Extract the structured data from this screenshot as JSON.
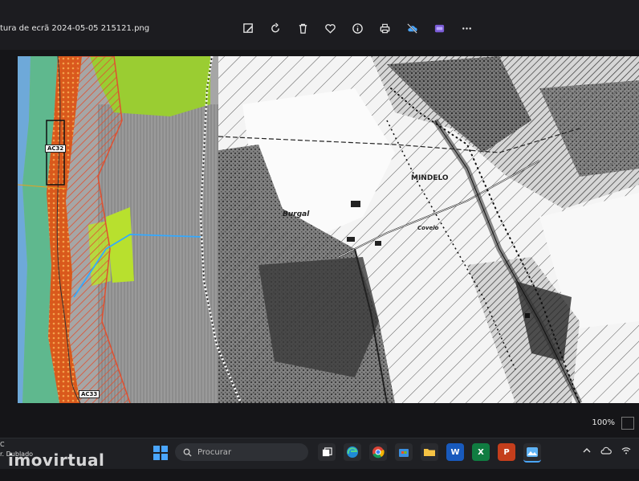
{
  "window": {
    "title": "tura de ecrã 2024-05-05 215121.png"
  },
  "toolbar": {
    "items": [
      {
        "icon": "edit-image-icon"
      },
      {
        "icon": "rotate-icon"
      },
      {
        "icon": "trash-icon"
      },
      {
        "icon": "heart-icon"
      },
      {
        "icon": "info-icon"
      },
      {
        "icon": "print-icon"
      },
      {
        "icon": "cloud-off-icon"
      },
      {
        "icon": "clipchamp-icon"
      },
      {
        "icon": "more-icon"
      }
    ]
  },
  "map": {
    "labels": {
      "ac32": "AC32",
      "ac33": "AC33",
      "burgal": "Burgal",
      "mindelo": "MINDELO",
      "covelo": "Covelo"
    },
    "colors": {
      "green": "#9acd32",
      "orange": "#e2621f",
      "teal": "#5fb88e",
      "gray": "#8c8c8c",
      "blue": "#33a9ff"
    }
  },
  "status": {
    "zoom": "100%"
  },
  "taskbar": {
    "search_placeholder": "Procurar",
    "left_stub_line1": "C",
    "left_stub_line2": "r. Dublado"
  },
  "watermark": "imovirtual"
}
